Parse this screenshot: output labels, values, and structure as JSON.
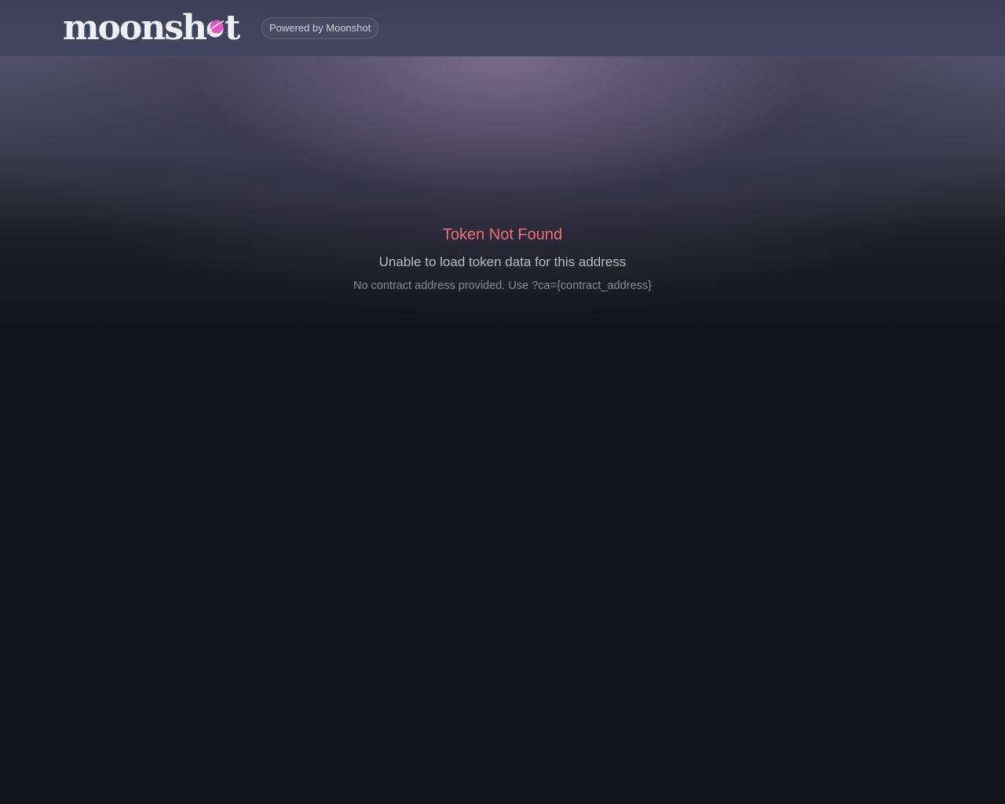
{
  "header": {
    "logo": {
      "text_before": "moonsh",
      "text_after": "t",
      "moon_icon": "moon-planet-icon",
      "moon_color": "#e056c8"
    },
    "powered_badge": "Powered by Moonshot"
  },
  "error": {
    "title": "Token Not Found",
    "subtitle": "Unable to load token data for this address",
    "hint": "No contract address provided. Use ?ca={contract_address}"
  },
  "colors": {
    "background": "#13131c",
    "header": "#424460",
    "error_title": "#ee6f78",
    "subtitle": "#b9bac6",
    "hint": "#8a8b98"
  }
}
